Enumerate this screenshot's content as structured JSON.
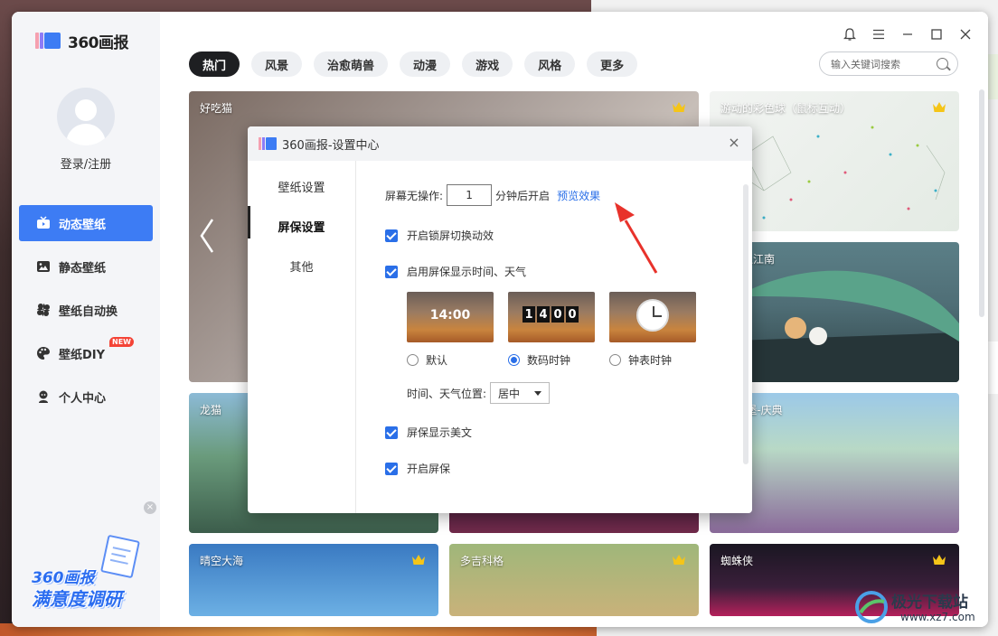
{
  "app": {
    "logo_text": "360画报",
    "login_label": "登录/注册",
    "window_controls": [
      "bell-icon",
      "menu-icon",
      "minimize-icon",
      "maximize-icon",
      "close-icon"
    ]
  },
  "sidebar": {
    "items": [
      {
        "label": "动态壁纸",
        "icon": "tv-icon",
        "active": true
      },
      {
        "label": "静态壁纸",
        "icon": "image-icon",
        "active": false
      },
      {
        "label": "壁纸自动换",
        "icon": "pinwheel-icon",
        "active": false
      },
      {
        "label": "壁纸DIY",
        "icon": "palette-icon",
        "active": false,
        "badge": "NEW"
      },
      {
        "label": "个人中心",
        "icon": "user-icon",
        "active": false
      }
    ],
    "survey": {
      "line1": "360画报",
      "line2": "满意度调研"
    }
  },
  "tabs": [
    "热门",
    "风景",
    "治愈萌兽",
    "动漫",
    "游戏",
    "风格",
    "更多"
  ],
  "active_tab": "热门",
  "search": {
    "placeholder": "输入关键词搜索"
  },
  "cards": [
    {
      "title": "好吃猫",
      "crown": true
    },
    {
      "title": "游动的彩色球（鼠标互动）",
      "crown": true
    },
    {
      "title": "烟雨入江南",
      "crown": false
    },
    {
      "title": "龙猫",
      "crown": false
    },
    {
      "title": "",
      "crown": false
    },
    {
      "title": "陆-城堡-庆典",
      "crown": false
    },
    {
      "title": "晴空大海",
      "crown": true
    },
    {
      "title": "多吉科格",
      "crown": true
    },
    {
      "title": "蜘蛛侠",
      "crown": true
    }
  ],
  "dialog": {
    "title": "360画报-设置中心",
    "nav": [
      "壁纸设置",
      "屏保设置",
      "其他"
    ],
    "nav_selected": "屏保设置",
    "idle_prefix": "屏幕无操作:",
    "idle_minutes": "1",
    "idle_suffix": "分钟后开启",
    "preview_link": "预览效果",
    "opt_lock_anim": "开启锁屏切换动效",
    "opt_show_time_weather": "启用屏保显示时间、天气",
    "thumb_default_time": "14:00",
    "thumb_digital_digits": [
      "1",
      "4",
      "0",
      "0"
    ],
    "clock_styles": [
      {
        "label": "默认",
        "selected": false
      },
      {
        "label": "数码时钟",
        "selected": true
      },
      {
        "label": "钟表时钟",
        "selected": false
      }
    ],
    "position_label": "时间、天气位置:",
    "position_value": "居中",
    "opt_show_text": "屏保显示美文",
    "opt_enable_screensaver": "开启屏保"
  },
  "watermark": {
    "line1": "极光下载站",
    "line2": "www.xz7.com"
  },
  "colors": {
    "accent": "#3d7cf4",
    "link": "#2a6fe8",
    "tab_active_bg": "#1e1f22",
    "annotation_red": "#e8322b"
  }
}
